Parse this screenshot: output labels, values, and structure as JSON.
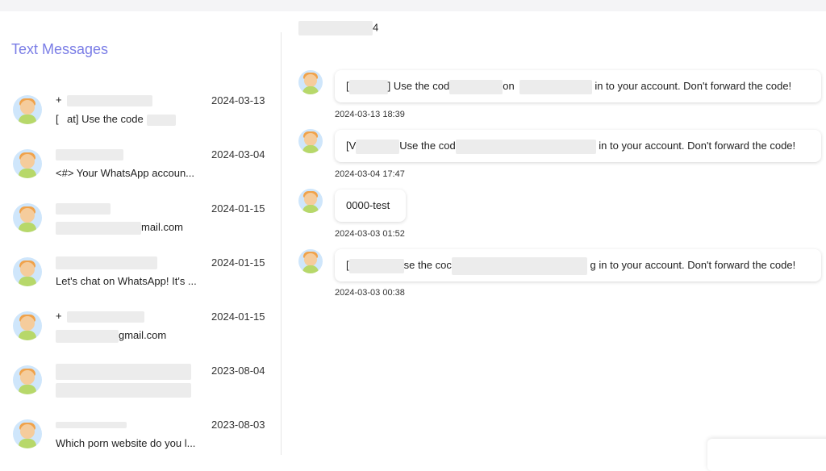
{
  "header": {
    "contact_suffix": "4"
  },
  "sidebar": {
    "title": "Text Messages",
    "conversations": [
      {
        "name": "+",
        "date": "2024-03-13",
        "preview": "[    at] Use the code"
      },
      {
        "name": "",
        "date": "2024-03-04",
        "preview": "<#> Your WhatsApp accoun..."
      },
      {
        "name": "",
        "date": "2024-01-15",
        "preview": "mail.com"
      },
      {
        "name": "",
        "date": "2024-01-15",
        "preview": "Let's chat on WhatsApp! It's ..."
      },
      {
        "name": "+",
        "date": "2024-01-15",
        "preview": "gmail.com"
      },
      {
        "name": "",
        "date": "2023-08-04",
        "preview": ""
      },
      {
        "name": "",
        "date": "2023-08-03",
        "preview": "Which porn website do you l..."
      }
    ]
  },
  "messages": [
    {
      "text_start": "[",
      "text_mid": "] Use the cod",
      "text_on": "on",
      "text_end": "in to your account. Don't forward the code!",
      "time": "2024-03-13 18:39"
    },
    {
      "text_start": "[V",
      "text_mid": "Use the cod",
      "text_end": "in to your account. Don't forward the code!",
      "time": "2024-03-04 17:47"
    },
    {
      "text": "0000-test",
      "time": "2024-03-03 01:52"
    },
    {
      "text_start": "[",
      "text_mid": "se the coc",
      "text_end": "g in to your account. Don't forward the code!",
      "time": "2024-03-03 00:38"
    }
  ],
  "colors": {
    "accent": "#7a7de6",
    "background": "#ffffff",
    "divider": "#e6e6e6"
  },
  "icons": {
    "avatar": "user-avatar-icon"
  }
}
